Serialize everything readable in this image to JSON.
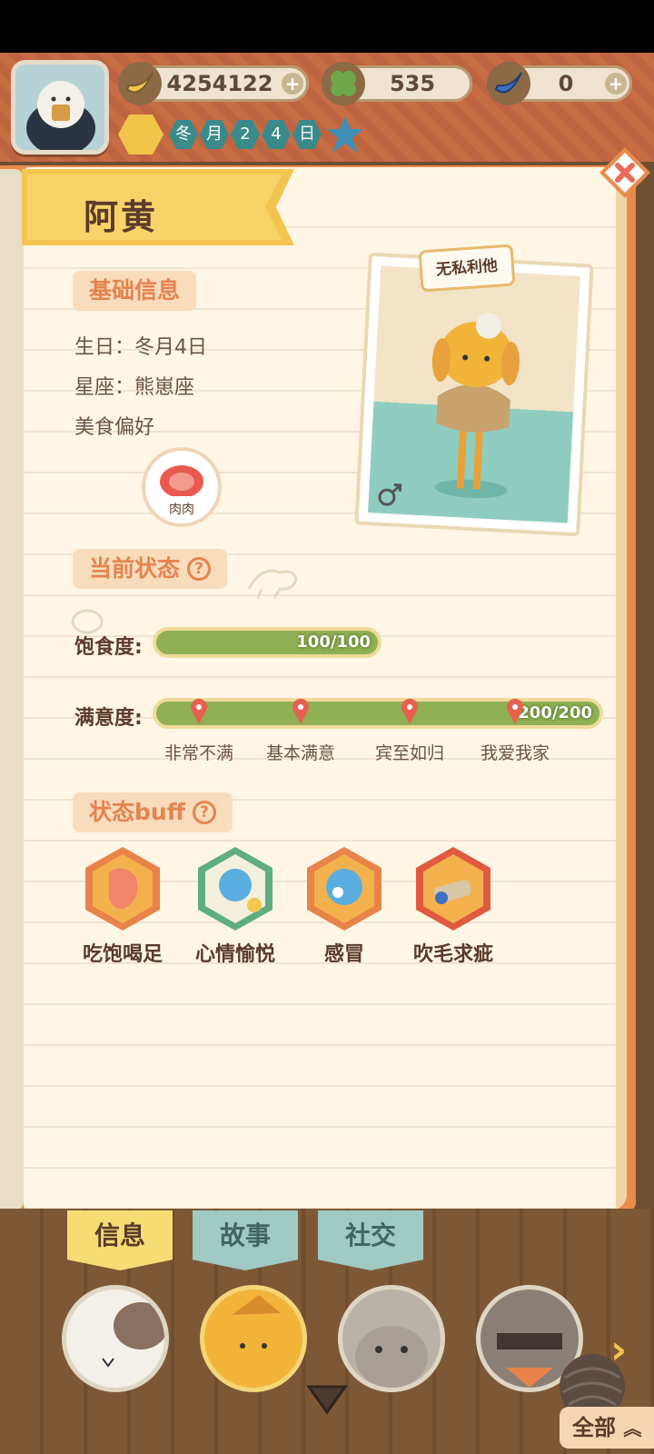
{
  "resources": {
    "banana": {
      "value": "4254122",
      "icon": "banana-icon"
    },
    "clover": {
      "value": "535",
      "icon": "clover-icon"
    },
    "blue_banana": {
      "value": "0",
      "icon": "blue-banana-icon"
    }
  },
  "calendar": [
    "冬",
    "月",
    "2",
    "4",
    "日"
  ],
  "character": {
    "name": "阿黄",
    "trait": "无私利他",
    "gender_icon": "male-icon"
  },
  "basic_info": {
    "title": "基础信息",
    "birthday": "生日：冬月4日",
    "zodiac": "星座：熊崽座",
    "food_pref_label": "美食偏好",
    "food": "肉肉"
  },
  "status": {
    "title": "当前状态",
    "fullness_label": "饱食度:",
    "fullness_value": "100/100",
    "fullness": 1.0,
    "satisfaction_label": "满意度:",
    "satisfaction_value": "200/200",
    "satisfaction": 1.0,
    "milestones": [
      "非常不满",
      "基本满意",
      "宾至如归",
      "我爱我家"
    ]
  },
  "buffs": {
    "title": "状态buff",
    "items": [
      "吃饱喝足",
      "心情愉悦",
      "感冒",
      "吹毛求疵"
    ]
  },
  "tabs": [
    "信息",
    "故事",
    "社交"
  ],
  "all_button": "全部",
  "colors": {
    "accent": "#e4844f",
    "bar": "#8fb054",
    "tab_active": "#f6dd74",
    "tab_inactive": "#9fcbc4"
  }
}
